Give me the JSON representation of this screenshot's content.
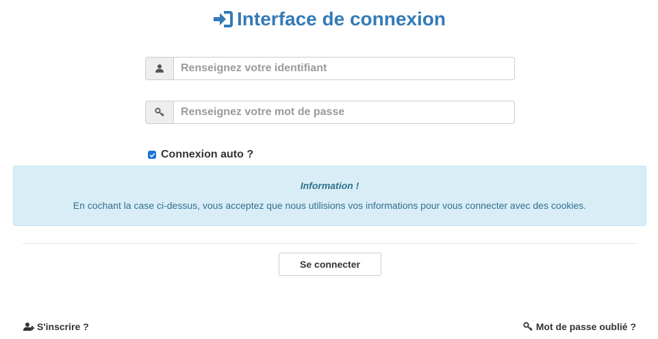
{
  "header": {
    "title": "Interface de connexion",
    "icon": "sign-in-icon",
    "color": "#337ab7"
  },
  "form": {
    "username": {
      "icon": "user-icon",
      "placeholder": "Renseignez votre identifiant",
      "value": ""
    },
    "password": {
      "icon": "key-icon",
      "placeholder": "Renseignez votre mot de passe",
      "value": ""
    },
    "remember": {
      "label": "Connexion auto ?",
      "checked": true
    }
  },
  "info": {
    "title": "Information !",
    "text": "En cochant la case ci-dessus, vous acceptez que nous utilisions vos informations pour vous connecter avec des cookies.",
    "background": "#d9edf7",
    "text_color": "#31708f"
  },
  "actions": {
    "submit_label": "Se connecter"
  },
  "footer": {
    "register": {
      "icon": "user-plus-icon",
      "label": "S'inscrire ?"
    },
    "forgot": {
      "icon": "key-icon",
      "label": "Mot de passe oublié ?"
    }
  }
}
